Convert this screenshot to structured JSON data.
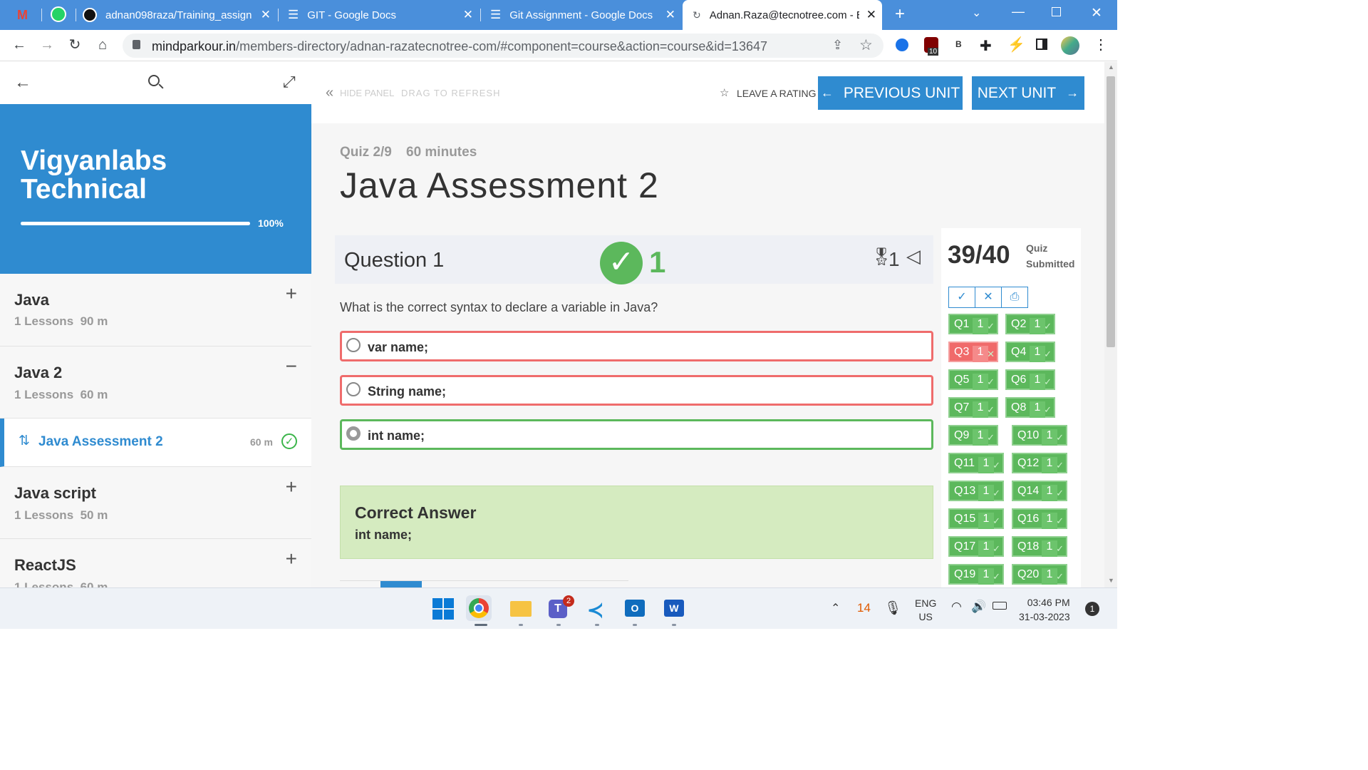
{
  "browser": {
    "tabs": [
      {
        "title": "adnan098raza/Training_assignm",
        "active": false
      },
      {
        "title": "GIT - Google Docs",
        "active": false
      },
      {
        "title": "Git Assignment - Google Docs",
        "active": false
      },
      {
        "title": "Adnan.Raza@tecnotree.com - E",
        "active": true
      }
    ],
    "url_host": "mindparkour.in",
    "url_path": "/members-directory/adnan-razatecnotree-com/#component=course&action=course&id=13647",
    "extension_badge": "10",
    "extension_letter": "B"
  },
  "sidebar": {
    "course_title_line1": "Vigyanlabs",
    "course_title_line2": "Technical",
    "progress_percent": 100,
    "progress_label": "100%",
    "sections": [
      {
        "name": "Java",
        "meta": "1 Lessons  90 m",
        "toggle": "+"
      },
      {
        "name": "Java 2",
        "meta": "1 Lessons  60 m",
        "toggle": "−"
      },
      {
        "name": "Java script",
        "meta": "1 Lessons  50 m",
        "toggle": "+"
      },
      {
        "name": "ReactJS",
        "meta": "1 Lessons  60 m",
        "toggle": "+"
      }
    ],
    "active_unit": {
      "title": "Java Assessment 2",
      "duration": "60 m"
    }
  },
  "toolbar": {
    "hide_panel": "HIDE PANEL",
    "drag_refresh": "DRAG TO REFRESH",
    "leave_rating": "LEAVE A RATING",
    "previous_unit": "PREVIOUS UNIT",
    "next_unit": "NEXT UNIT"
  },
  "quiz": {
    "counter": "Quiz 2/9",
    "duration": "60 minutes",
    "title": "Java Assessment 2",
    "question_label": "Question 1",
    "question_score": "1",
    "marks": "1",
    "question_text": "What is the correct syntax to declare a variable in Java?",
    "options": [
      {
        "label": "var name;",
        "state": "wrong"
      },
      {
        "label": "String name;",
        "state": "wrong"
      },
      {
        "label": "int name;",
        "state": "correct"
      }
    ],
    "correct_heading": "Correct Answer",
    "correct_value": "int name;"
  },
  "summary": {
    "score": "39/40",
    "status_line1": "Quiz",
    "status_line2": "Submitted",
    "questions": [
      {
        "q": "Q1",
        "v": "1",
        "ok": true
      },
      {
        "q": "Q2",
        "v": "1",
        "ok": true
      },
      {
        "q": "Q3",
        "v": "1",
        "ok": false
      },
      {
        "q": "Q4",
        "v": "1",
        "ok": true
      },
      {
        "q": "Q5",
        "v": "1",
        "ok": true
      },
      {
        "q": "Q6",
        "v": "1",
        "ok": true
      },
      {
        "q": "Q7",
        "v": "1",
        "ok": true
      },
      {
        "q": "Q8",
        "v": "1",
        "ok": true
      },
      {
        "q": "Q9",
        "v": "1",
        "ok": true
      },
      {
        "q": "Q10",
        "v": "1",
        "ok": true
      },
      {
        "q": "Q11",
        "v": "1",
        "ok": true
      },
      {
        "q": "Q12",
        "v": "1",
        "ok": true
      },
      {
        "q": "Q13",
        "v": "1",
        "ok": true
      },
      {
        "q": "Q14",
        "v": "1",
        "ok": true
      },
      {
        "q": "Q15",
        "v": "1",
        "ok": true
      },
      {
        "q": "Q16",
        "v": "1",
        "ok": true
      },
      {
        "q": "Q17",
        "v": "1",
        "ok": true
      },
      {
        "q": "Q18",
        "v": "1",
        "ok": true
      },
      {
        "q": "Q19",
        "v": "1",
        "ok": true
      },
      {
        "q": "Q20",
        "v": "1",
        "ok": true
      }
    ]
  },
  "taskbar": {
    "teams_badge": "2",
    "tray_number": "14",
    "lang_line1": "ENG",
    "lang_line2": "US",
    "time": "03:46 PM",
    "date": "31-03-2023",
    "notifications": "1"
  },
  "colors": {
    "accent": "#2f8bd0",
    "success": "#5cb85c",
    "danger": "#f06a6a",
    "tab_bar": "#4a8fdb"
  }
}
